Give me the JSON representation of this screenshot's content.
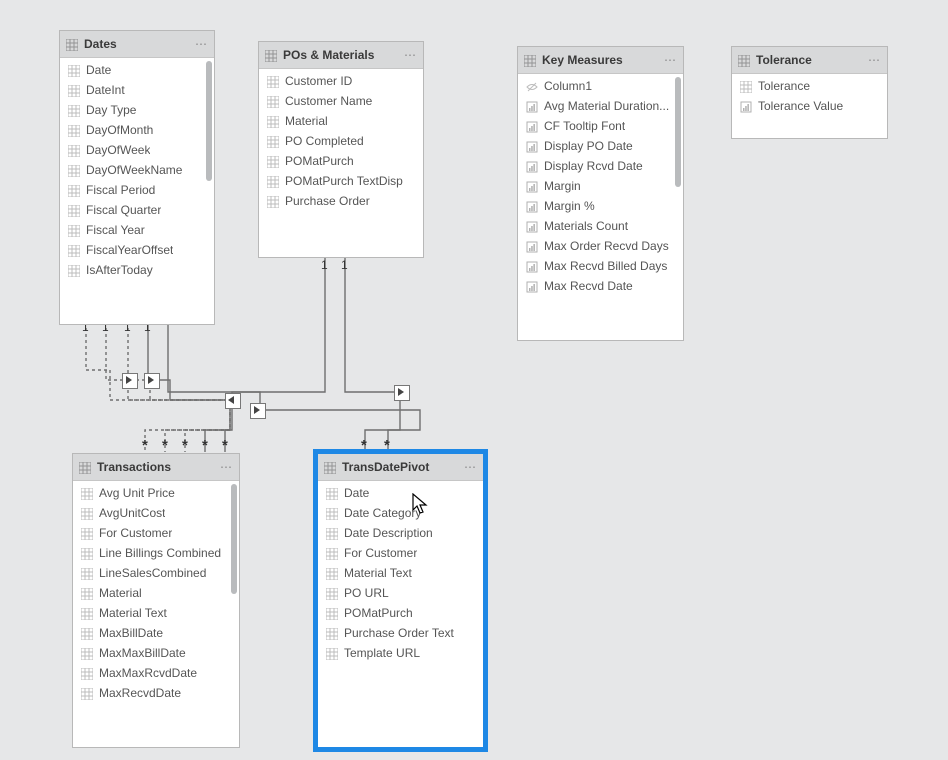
{
  "tables": {
    "dates": {
      "title": "Dates",
      "fields": [
        "Date",
        "DateInt",
        "Day Type",
        "DayOfMonth",
        "DayOfWeek",
        "DayOfWeekName",
        "Fiscal Period",
        "Fiscal Quarter",
        "Fiscal Year",
        "FiscalYearOffset",
        "IsAfterToday"
      ]
    },
    "pos": {
      "title": "POs & Materials",
      "fields": [
        "Customer ID",
        "Customer Name",
        "Material",
        "PO Completed",
        "POMatPurch",
        "POMatPurch TextDisp",
        "Purchase Order"
      ]
    },
    "measures": {
      "title": "Key Measures",
      "fields": [
        "Column1",
        "Avg Material Duration...",
        "CF Tooltip Font",
        "Display PO Date",
        "Display Rcvd Date",
        "Margin",
        "Margin %",
        "Materials Count",
        "Max Order Recvd Days",
        "Max Recvd Billed Days",
        "Max Recvd Date"
      ],
      "iconTypes": [
        "hidden",
        "measure",
        "measure",
        "measure",
        "measure",
        "measure",
        "measure",
        "measure",
        "measure",
        "measure",
        "measure"
      ]
    },
    "tolerance": {
      "title": "Tolerance",
      "fields": [
        "Tolerance",
        "Tolerance Value"
      ],
      "iconTypes": [
        "column",
        "measure"
      ]
    },
    "transactions": {
      "title": "Transactions",
      "fields": [
        "Avg Unit Price",
        "AvgUnitCost",
        "For Customer",
        "Line Billings Combined",
        "LineSalesCombined",
        "Material",
        "Material Text",
        "MaxBillDate",
        "MaxMaxBillDate",
        "MaxMaxRcvdDate",
        "MaxRecvdDate"
      ]
    },
    "pivot": {
      "title": "TransDatePivot",
      "fields": [
        "Date",
        "Date Category",
        "Date Description",
        "For Customer",
        "Material Text",
        "PO URL",
        "POMatPurch",
        "Purchase Order Text",
        "Template URL"
      ]
    }
  },
  "relationship_cardinality": {
    "one": "1",
    "many": "*"
  }
}
